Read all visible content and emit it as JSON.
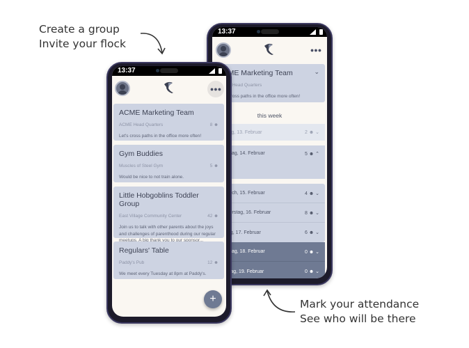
{
  "captions": {
    "top": [
      "Create a group",
      "Invite your flock"
    ],
    "bottom": [
      "Mark your attendance",
      "See who will be there"
    ]
  },
  "status_time": "13:37",
  "icons": {
    "profile": "avatar-icon",
    "logo": "bird-logo-icon",
    "groups": "groups-icon",
    "person": "person-icon",
    "add": "plus-icon"
  },
  "colors": {
    "card": "#cdd3e2",
    "dark_row": "#6f7a93",
    "background": "#faf7f2"
  },
  "groups_screen": {
    "groups": [
      {
        "name": "ACME Marketing Team",
        "location": "ACME Head Quarters",
        "members": "8",
        "description": "Let's cross paths in the office more often!"
      },
      {
        "name": "Gym Buddies",
        "location": "Muscles of Steel Gym",
        "members": "5",
        "description": "Would be nice to not train alone."
      },
      {
        "name": "Little Hobgoblins Toddler Group",
        "location": "East Village Community Center",
        "members": "42",
        "description": "Join us to talk with other parents about the joys and challenges of parenthood during our regular meetups. A big thank you to our sponsor..."
      },
      {
        "name": "Regulars' Table",
        "location": "Paddy's Pub",
        "members": "12",
        "description": "We meet every Tuesday at 8pm at Paddy's."
      }
    ],
    "fab": "+"
  },
  "detail_screen": {
    "group": {
      "name": "ACME Marketing Team",
      "location": "ACME Head Quarters",
      "description": "Let's cross paths in the office more often!"
    },
    "section": "this week",
    "days": [
      {
        "label": "Montag, 13. Februar",
        "count": "2"
      },
      {
        "label": "Dienstag, 14. Februar",
        "count": "5"
      },
      {
        "label": "Mittwoch, 15. Februar",
        "count": "4"
      },
      {
        "label": "Donnerstag, 16. Februar",
        "count": "8"
      },
      {
        "label": "Freitag, 17. Februar",
        "count": "6"
      },
      {
        "label": "Samstag, 18. Februar",
        "count": "0"
      },
      {
        "label": "Sonntag, 19. Februar",
        "count": "0"
      }
    ]
  }
}
